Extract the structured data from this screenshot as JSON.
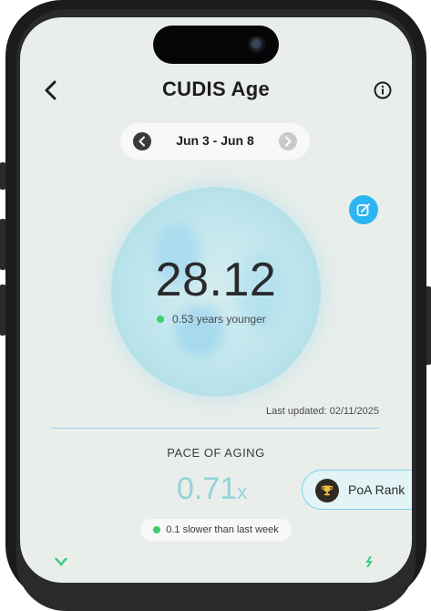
{
  "header": {
    "title": "CUDIS Age",
    "back_icon": "chevron-left-icon",
    "info_icon": "info-circle-icon"
  },
  "date_range": {
    "label": "Jun 3 - Jun 8",
    "prev_icon": "chevron-left-icon",
    "next_icon": "chevron-right-icon"
  },
  "age": {
    "value": "28.12",
    "delta_text": "0.53 years younger",
    "delta_color": "#3ccf6a",
    "edit_icon": "edit-icon"
  },
  "last_updated": "Last updated: 02/11/2025",
  "pace": {
    "label": "PACE OF AGING",
    "value": "0.71",
    "unit": "x",
    "comparison": "0.1 slower than last week",
    "value_color": "#93d3da"
  },
  "rank_button": {
    "label": "PoA Rank",
    "icon": "trophy-icon"
  },
  "colors": {
    "accent": "#2bb6f2",
    "background": "#eaeeea",
    "divider": "#8fd8ee"
  }
}
